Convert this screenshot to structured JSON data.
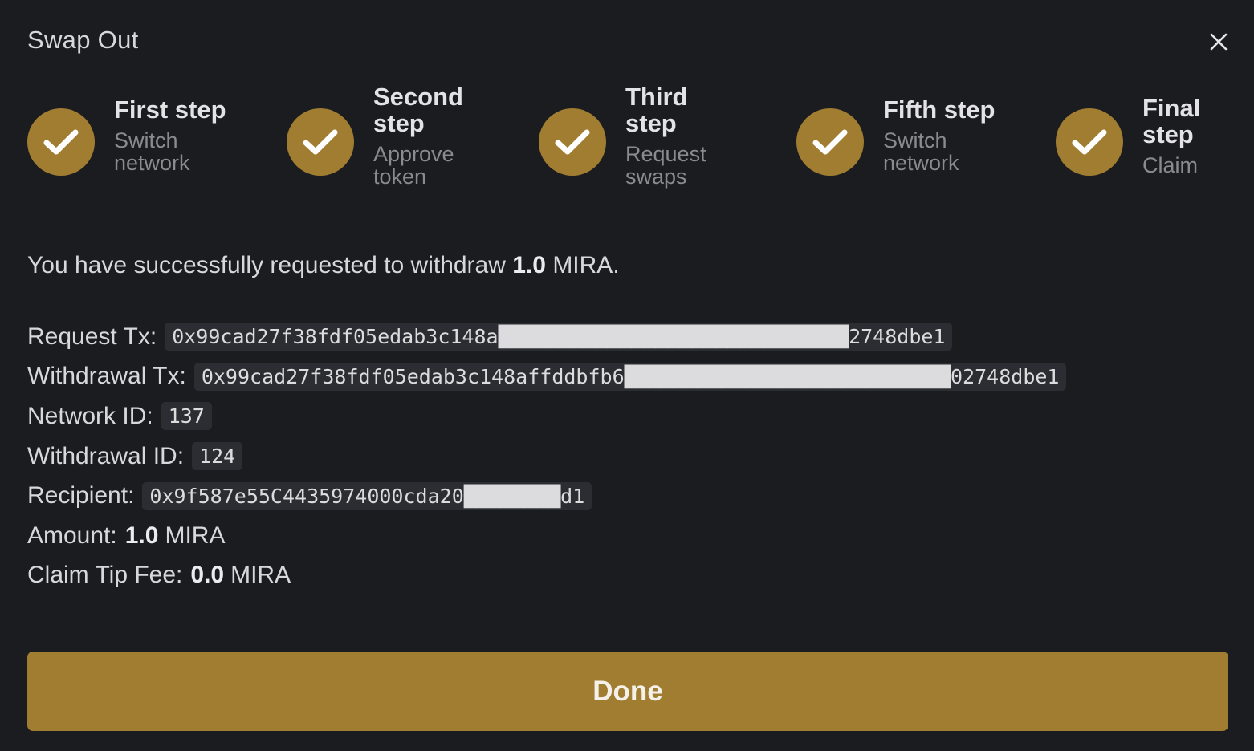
{
  "dialog": {
    "title": "Swap Out"
  },
  "steps": [
    {
      "name": "First step",
      "desc": "Switch network",
      "done": true
    },
    {
      "name": "Second step",
      "desc": "Approve token",
      "done": true
    },
    {
      "name": "Third step",
      "desc": "Request swaps",
      "done": true
    },
    {
      "name": "Fifth step",
      "desc": "Switch network",
      "done": true
    },
    {
      "name": "Final step",
      "desc": "Claim",
      "done": true
    }
  ],
  "message": {
    "prefix": "You have successfully requested to withdraw",
    "amount": "1.0",
    "unit": "MIRA."
  },
  "details": {
    "request_tx": {
      "label": "Request Tx:",
      "value": "0x99cad27f38fdf05edab3c148a█████████████████████████████2748dbe1"
    },
    "withdrawal_tx": {
      "label": "Withdrawal Tx:",
      "value": "0x99cad27f38fdf05edab3c148affddbfb6███████████████████████████02748dbe1"
    },
    "network_id": {
      "label": "Network ID:",
      "value": "137"
    },
    "withdrawal_id": {
      "label": "Withdrawal ID:",
      "value": "124"
    },
    "recipient": {
      "label": "Recipient:",
      "value": "0x9f587e55C4435974000cda20████████d1"
    },
    "amount": {
      "label": "Amount:",
      "value": "1.0",
      "unit": "MIRA"
    },
    "claim_tip_fee": {
      "label": "Claim Tip Fee:",
      "value": "0.0",
      "unit": "MIRA"
    }
  },
  "actions": {
    "done_label": "Done"
  },
  "colors": {
    "background": "#1b1c20",
    "accent": "#a07d31",
    "code_bg": "#2c2d32"
  }
}
